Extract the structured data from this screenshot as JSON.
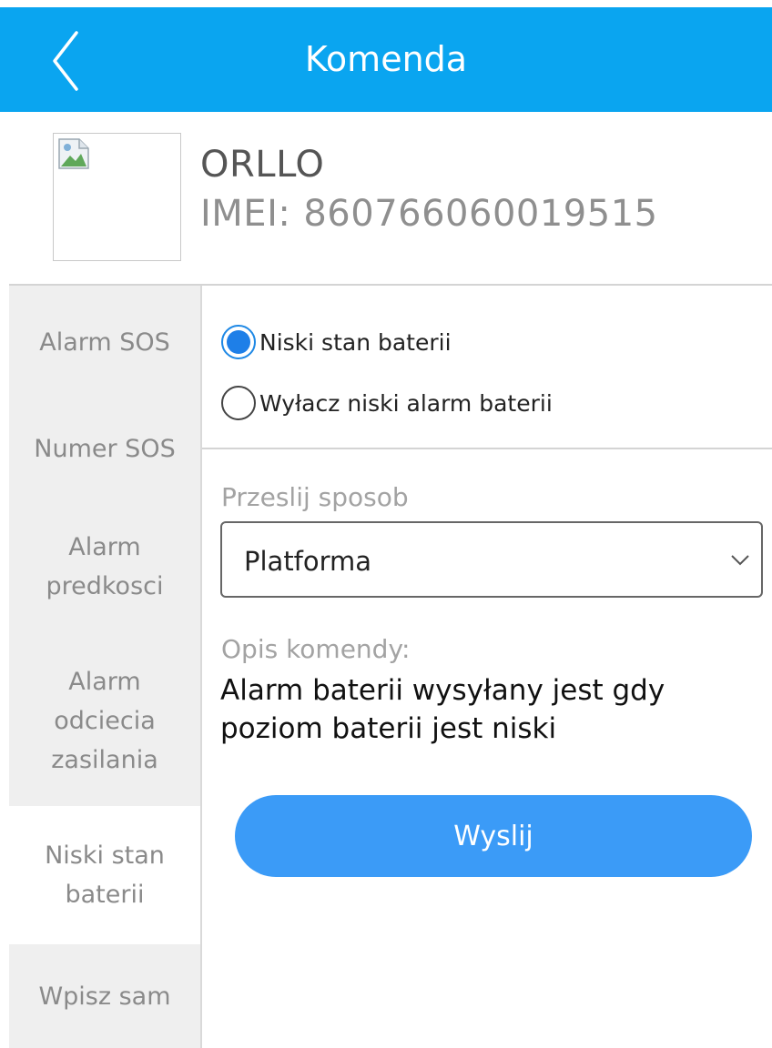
{
  "header": {
    "title": "Komenda",
    "back_icon": "chevron-left-icon"
  },
  "device": {
    "name": "ORLLO",
    "imei_label": "IMEI:",
    "imei_value": "860766060019515",
    "image_icon": "broken-image-icon"
  },
  "sidebar": {
    "items": [
      {
        "label": "Alarm SOS"
      },
      {
        "label": "Numer SOS"
      },
      {
        "label": "Alarm\npredkosci"
      },
      {
        "label": "Alarm\nodciecia\nzasilania"
      },
      {
        "label": "Niski stan\nbaterii",
        "active": true
      },
      {
        "label": "Wpisz sam"
      }
    ]
  },
  "options": {
    "items": [
      {
        "label": "Niski stan baterii",
        "checked": true
      },
      {
        "label": "Wyłacz niski alarm baterii",
        "checked": false
      }
    ]
  },
  "send_method": {
    "label": "Przeslij sposob",
    "selected": "Platforma"
  },
  "description": {
    "label": "Opis komendy:",
    "text": "Alarm baterii wysyłany jest gdy poziom baterii jest niski"
  },
  "actions": {
    "send_label": "Wyslij"
  },
  "colors": {
    "header_bg": "#0aa5f0",
    "radio_checked": "#1e7fe8",
    "button_bg": "#3b9bf7",
    "sidebar_bg": "#efefef"
  }
}
